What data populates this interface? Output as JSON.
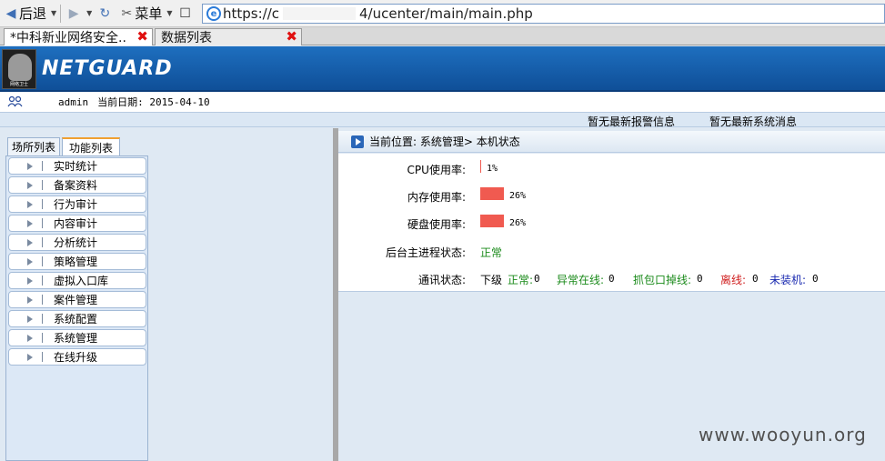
{
  "browser": {
    "back_label": "后退",
    "menu_label": "菜单",
    "url_visible_prefix": "https://c",
    "url_visible_suffix": "4/ucenter/main/main.php",
    "tabs": [
      {
        "label": "*中科新业网络安全..",
        "active": true
      },
      {
        "label": "数据列表",
        "active": false
      }
    ]
  },
  "header": {
    "brand": "NETGUARD",
    "logo_caption": "网络卫士"
  },
  "userbar": {
    "user": "admin",
    "date_label": "当前日期: 2015-04-10"
  },
  "messages": {
    "alarm": "暂无最新报警信息",
    "system": "暂无最新系统消息"
  },
  "left_tabs": [
    "场所列表",
    "功能列表"
  ],
  "menu": [
    "实时统计",
    "备案资料",
    "行为审计",
    "内容审计",
    "分析统计",
    "策略管理",
    "虚拟入口库",
    "案件管理",
    "系统配置",
    "系统管理",
    "在线升级"
  ],
  "breadcrumb": "当前位置: 系统管理> 本机状态",
  "status": {
    "cpu_label": "CPU使用率:",
    "cpu_value": "1%",
    "cpu_percent": 1,
    "mem_label": "内存使用率:",
    "mem_value": "26%",
    "mem_percent": 26,
    "disk_label": "硬盘使用率:",
    "disk_value": "26%",
    "disk_percent": 26,
    "process_label": "后台主进程状态:",
    "process_value": "正常",
    "comm_label": "通讯状态:",
    "comm_sub": "下级",
    "normal_label": "正常:",
    "normal_value": "0",
    "abnormal_label": "异常在线:",
    "abnormal_value": "0",
    "capture_label": "抓包口掉线:",
    "capture_value": "0",
    "offline_label": "离线:",
    "offline_value": "0",
    "uninstalled_label": "未装机:",
    "uninstalled_value": "0"
  },
  "colors": {
    "header_blue": "#1e6fbf",
    "usage_bar": "#f05a50",
    "ok_green": "#1a8a1a",
    "offline_red": "#d02020",
    "uninstalled_blue": "#1a2ab0"
  },
  "watermark": "www.wooyun.org"
}
